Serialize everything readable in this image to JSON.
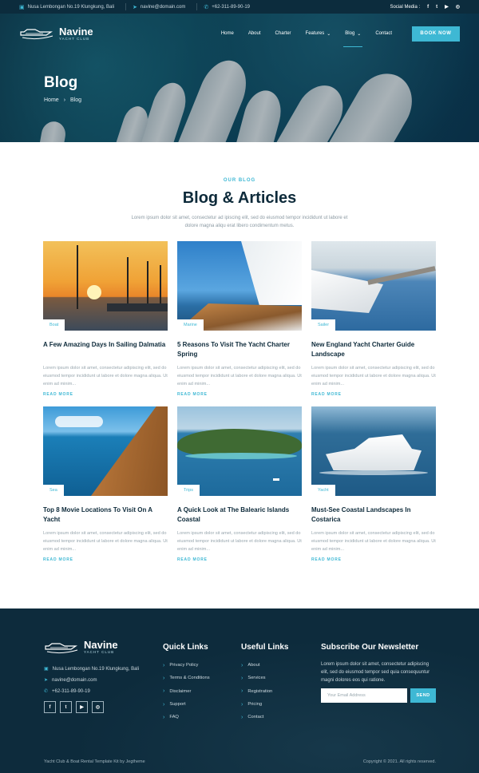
{
  "topbar": {
    "address": "Nusa Lembongan No.19 Klungkung, Bali",
    "email": "navine@domain.com",
    "phone": "+62-311-89-90-19",
    "social_label": "Social Media :",
    "social_icons": [
      "facebook-icon",
      "twitter-icon",
      "youtube-icon",
      "instagram-icon"
    ]
  },
  "brand": {
    "name": "Navine",
    "tagline": "YACHT CLUB"
  },
  "nav": {
    "items": [
      "Home",
      "About",
      "Charter",
      "Features",
      "Blog",
      "Contact"
    ],
    "active": "Blog",
    "cta": "BOOK NOW"
  },
  "hero": {
    "title": "Blog",
    "breadcrumb": [
      "Home",
      "Blog"
    ]
  },
  "section": {
    "eyebrow": "OUR BLOG",
    "title": "Blog & Articles",
    "lead": "Lorem ipsum dolor sit amet, consectetur ad ipiscing elit, sed do eiusmod tempor incididunt ut labore et dolore magna aliqu erat libero condimentum metus."
  },
  "posts": [
    {
      "tag": "Boat",
      "title": "A Few Amazing Days In Sailing Dalmatia",
      "excerpt": "Lorem ipsum dolor sit amet, consectetur adipiscing elit, sed do eiusmod tempor incididunt ut labore et dolore magna aliqua. Ut enim ad minim...",
      "more": "READ MORE"
    },
    {
      "tag": "Marine",
      "title": "5 Reasons To Visit The Yacht Charter Spring",
      "excerpt": "Lorem ipsum dolor sit amet, consectetur adipiscing elit, sed do eiusmod tempor incididunt ut labore et dolore magna aliqua. Ut enim ad minim...",
      "more": "READ MORE"
    },
    {
      "tag": "Sailer",
      "title": "New England Yacht Charter Guide Landscape",
      "excerpt": "Lorem ipsum dolor sit amet, consectetur adipiscing elit, sed do eiusmod tempor incididunt ut labore et dolore magna aliqua. Ut enim ad minim...",
      "more": "READ MORE"
    },
    {
      "tag": "Sea",
      "title": "Top 8 Movie Locations To Visit On A Yacht",
      "excerpt": "Lorem ipsum dolor sit amet, consectetur adipiscing elit, sed do eiusmod tempor incididunt ut labore et dolore magna aliqua. Ut enim ad minim...",
      "more": "READ MORE"
    },
    {
      "tag": "Trips",
      "title": "A Quick Look at The Balearic Islands Coastal",
      "excerpt": "Lorem ipsum dolor sit amet, consectetur adipiscing elit, sed do eiusmod tempor incididunt ut labore et dolore magna aliqua. Ut enim ad minim...",
      "more": "READ MORE"
    },
    {
      "tag": "Yacht",
      "title": "Must-See Coastal Landscapes In Costarica",
      "excerpt": "Lorem ipsum dolor sit amet, consectetur adipiscing elit, sed do eiusmod tempor incididunt ut labore et dolore magna aliqua. Ut enim ad minim...",
      "more": "READ MORE"
    }
  ],
  "footer": {
    "address": "Nusa Lembongan No.19 Klungkung, Bali",
    "email": "navine@domain.com",
    "phone": "+62-311-89-90-19",
    "social_icons": [
      "facebook-icon",
      "twitter-icon",
      "youtube-icon",
      "instagram-icon"
    ],
    "quick_links_title": "Quick Links",
    "quick_links": [
      "Privacy Policy",
      "Terms & Conditions",
      "Disclaimer",
      "Support",
      "FAQ"
    ],
    "useful_links_title": "Useful Links",
    "useful_links": [
      "About",
      "Services",
      "Registration",
      "Pricing",
      "Contact"
    ],
    "newsletter_title": "Subscribe Our Newsletter",
    "newsletter_text": "Lorem ipsum dolor sit amet, consectetur adipiscing elit, sed do eiusmod tempor sed quia consequuntur magni dolores eos qui ratione.",
    "email_placeholder": "Your Email Address",
    "send_label": "SEND",
    "credit": "Yacht Club & Boat Rental Template Kit by Jegtheme",
    "copyright": "Copyright © 2021. All rights reserved."
  },
  "colors": {
    "accent": "#3eb8d4",
    "dark": "#0d2b3c",
    "heading": "#0d2a3a"
  }
}
